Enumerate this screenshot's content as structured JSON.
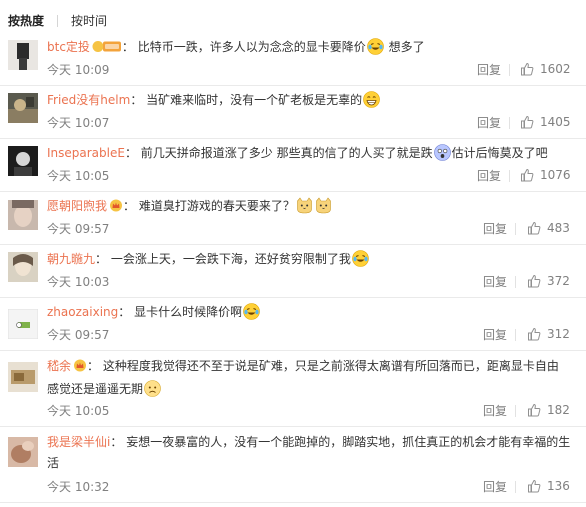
{
  "tabs": {
    "hot": "按热度",
    "time": "按时间"
  },
  "comments": [
    {
      "user": "btc定投",
      "sep": "：",
      "text": "比特币一跌，许多人以为念念的显卡要降价",
      "tail": "想多了",
      "time": "今天 10:09",
      "reply": "回复",
      "likes": "1602"
    },
    {
      "user": "Fried没有helm",
      "sep": "：",
      "text": "当矿难来临时，没有一个矿老板是无辜的",
      "time": "今天 10:07",
      "reply": "回复",
      "likes": "1405"
    },
    {
      "user": "InseparableE",
      "sep": "：",
      "text": "前几天拼命报道涨了多少  那些真的信了的人买了就是跌",
      "tail": "估计后悔莫及了吧",
      "time": "今天 10:05",
      "reply": "回复",
      "likes": "1076"
    },
    {
      "user": "愿朝阳煦我",
      "sep": "：",
      "text": "难道臭打游戏的春天要来了？",
      "time": "今天 09:57",
      "reply": "回复",
      "likes": "483"
    },
    {
      "user": "朝九暆九",
      "sep": "：",
      "text": "一会涨上天，一会跌下海，还好贫穷限制了我",
      "time": "今天 10:03",
      "reply": "回复",
      "likes": "372"
    },
    {
      "user": "zhaozaixing",
      "sep": "：",
      "text": "显卡什么时候降价啊",
      "time": "今天 09:57",
      "reply": "回复",
      "likes": "312"
    },
    {
      "user": "嵇余",
      "sep": "：",
      "text": "这种程度我觉得还不至于说是矿难，只是之前涨得太离谱有所回落而已，距离显卡自由感觉还是遥遥无期",
      "time": "今天 10:05",
      "reply": "回复",
      "likes": "182"
    },
    {
      "user": "我是梁半仙i",
      "sep": "：",
      "text": "妄想一夜暴富的人，没有一个能跑掉的，脚踏实地，抓住真正的机会才能有幸福的生活",
      "time": "今天 10:32",
      "reply": "回复",
      "likes": "136"
    }
  ],
  "icons": [
    "vip-badge-icon",
    "crown-badge-icon",
    "laugh-cry-emoji-icon",
    "grin-emoji-icon",
    "shocked-emoji-icon",
    "cat-emoji-icon",
    "sad-emoji-icon",
    "thumbs-up-icon"
  ],
  "colors": {
    "username": "#eb7350",
    "meta": "#808080",
    "text": "#333333",
    "divider": "#eaeaea"
  }
}
